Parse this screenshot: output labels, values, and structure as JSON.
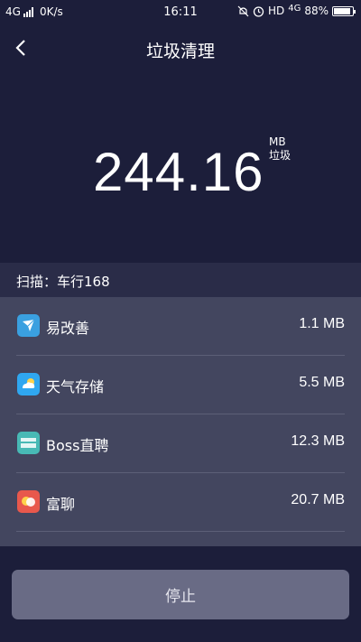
{
  "statusbar": {
    "network": "4G",
    "speed": "0K/s",
    "time": "16:11",
    "hd": "HD",
    "net2": "4G",
    "battery": "88%",
    "battery_level": 0.88
  },
  "header": {
    "title": "垃圾清理"
  },
  "total": {
    "value": "244.16",
    "unit": "MB",
    "unit_label": "垃圾"
  },
  "scan": {
    "text": "扫描：车行168"
  },
  "apps": [
    {
      "name": "易改善",
      "size": "1.1 MB",
      "icon": "paper-plane-icon",
      "color": "#3aa0e0"
    },
    {
      "name": "天气存储",
      "size": "5.5 MB",
      "icon": "cloud-icon",
      "color": "#2fa7f0"
    },
    {
      "name": "Boss直聘",
      "size": "12.3 MB",
      "icon": "boss-icon",
      "color": "#48b9b5"
    },
    {
      "name": "富聊",
      "size": "20.7 MB",
      "icon": "chat-bubble-icon",
      "color": "#e8584c"
    }
  ],
  "stop_button": {
    "label": "停止"
  },
  "colors": {
    "background": "#1c1e3a",
    "list": "#43465f",
    "button": "#696b85"
  }
}
